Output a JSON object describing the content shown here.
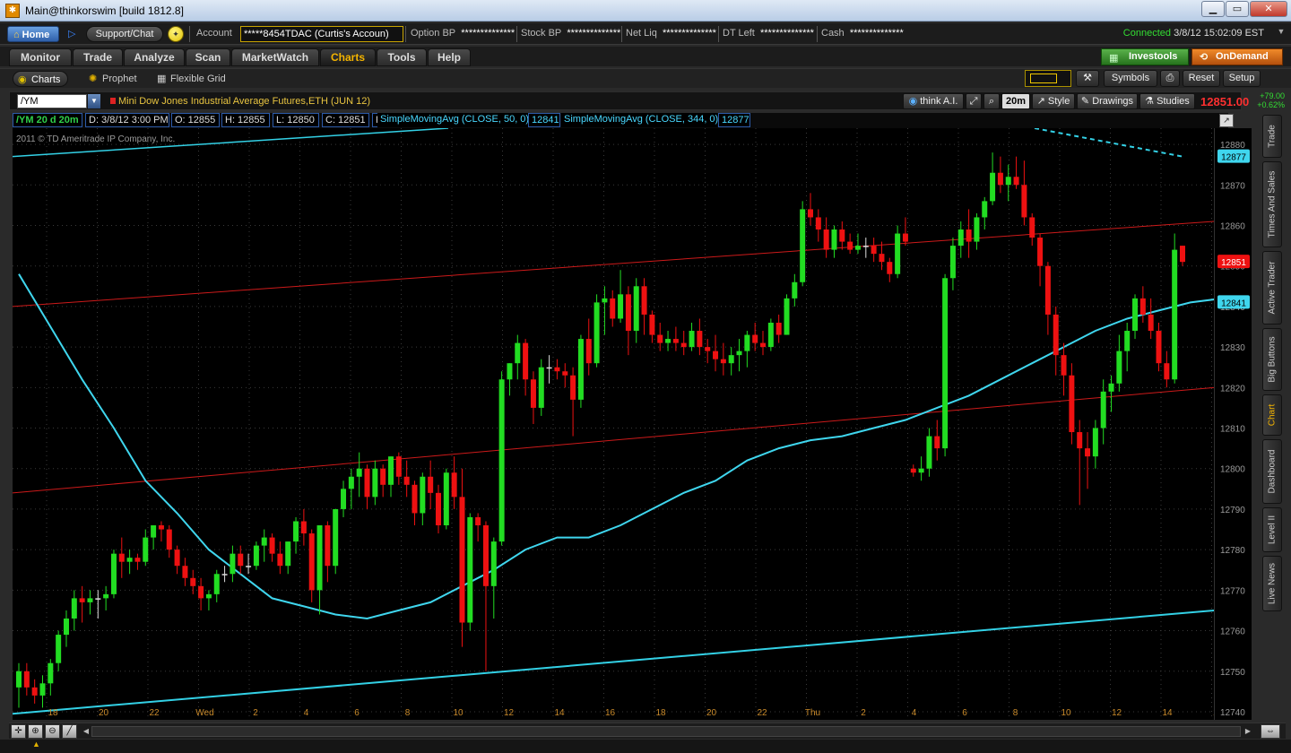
{
  "window": {
    "title": "Main@thinkorswim [build 1812.8]",
    "app_icon": "thinkorswim-icon",
    "controls": [
      "minimize",
      "maximize",
      "close"
    ]
  },
  "account_bar": {
    "home_label": "Home",
    "support_label": "Support/Chat",
    "account_label": "Account",
    "account_value": "*****8454TDAC (Curtis's Accoun)",
    "option_bp_label": "Option BP",
    "option_bp_value": "**************",
    "stock_bp_label": "Stock BP",
    "stock_bp_value": "**************",
    "net_liq_label": "Net Liq",
    "net_liq_value": "**************",
    "dt_left_label": "DT Left",
    "dt_left_value": "**************",
    "cash_label": "Cash",
    "cash_value": "**************",
    "connected_label": "Connected",
    "timestamp": "3/8/12 15:02:09 EST"
  },
  "main_tabs": {
    "items": [
      {
        "label": "Monitor",
        "active": false
      },
      {
        "label": "Trade",
        "active": false
      },
      {
        "label": "Analyze",
        "active": false
      },
      {
        "label": "Scan",
        "active": false
      },
      {
        "label": "MarketWatch",
        "active": false
      },
      {
        "label": "Charts",
        "active": true
      },
      {
        "label": "Tools",
        "active": false
      },
      {
        "label": "Help",
        "active": false
      }
    ],
    "investools_label": "Investools",
    "ondemand_label": "OnDemand"
  },
  "sub_tabs": {
    "charts_label": "Charts",
    "prophet_label": "Prophet",
    "flexible_grid_label": "Flexible Grid",
    "symbols_label": "Symbols",
    "reset_label": "Reset",
    "setup_label": "Setup"
  },
  "chart_header": {
    "symbol": "/YM",
    "description": "Mini Dow Jones Industrial Average Futures,ETH (JUN 12)",
    "think_ai_label": "think A.I.",
    "timeframe_label": "20m",
    "style_label": "Style",
    "drawings_label": "Drawings",
    "studies_label": "Studies",
    "last_price": "12851.00",
    "change": "+79.00",
    "change_pct": "+0.62%"
  },
  "study_bar": {
    "symbol_period": "/YM 20 d 20m",
    "date": "D: 3/8/12 3:00 PM",
    "open": "O: 12855",
    "high": "H: 12855",
    "low": "L: 12850",
    "close": "C: 12851",
    "range": "R: 5",
    "sma1_label": "SimpleMovingAvg (CLOSE, 50, 0)",
    "sma1_value": "12841",
    "sma2_label": "SimpleMovingAvg (CLOSE, 344, 0)",
    "sma2_value": "12877"
  },
  "side_tabs": [
    {
      "label": "Trade",
      "active": false
    },
    {
      "label": "Times And Sales",
      "active": false
    },
    {
      "label": "Active Trader",
      "active": false
    },
    {
      "label": "Big Buttons",
      "active": false
    },
    {
      "label": "Chart",
      "active": true
    },
    {
      "label": "Dashboard",
      "active": false
    },
    {
      "label": "Level II",
      "active": false
    },
    {
      "label": "Live News",
      "active": false
    }
  ],
  "colors": {
    "up": "#22dd22",
    "down": "#ee1111",
    "sma": "#3fd6ee",
    "channel": "#cc1a1a",
    "trend": "#33d1e6",
    "grid": "#3a3a3a",
    "accent": "#f4b400"
  },
  "chart_data": {
    "type": "candlestick",
    "copyright": "2011 © TD Ameritrade IP Company, Inc.",
    "y_ticks": [
      12740,
      12750,
      12760,
      12770,
      12780,
      12790,
      12800,
      12810,
      12820,
      12830,
      12840,
      12850,
      12860,
      12870,
      12880
    ],
    "ylim": [
      12738,
      12884
    ],
    "x_ticks": [
      "18",
      "20",
      "22",
      "Wed",
      "2",
      "4",
      "6",
      "8",
      "10",
      "12",
      "14",
      "16",
      "18",
      "20",
      "22",
      "Thu",
      "2",
      "4",
      "6",
      "8",
      "10",
      "12",
      "14",
      "16"
    ],
    "price_tags": [
      {
        "value": 12877,
        "label": "12877",
        "kind": "sma"
      },
      {
        "value": 12851,
        "label": "12851",
        "kind": "last"
      },
      {
        "value": 12841,
        "label": "12841",
        "kind": "sma"
      }
    ],
    "candles": [
      [
        12746,
        12752,
        12741,
        12750
      ],
      [
        12750,
        12752,
        12744,
        12746
      ],
      [
        12746,
        12748,
        12742,
        12744
      ],
      [
        12744,
        12749,
        12741,
        12747
      ],
      [
        12747,
        12753,
        12744,
        12752
      ],
      [
        12752,
        12760,
        12750,
        12759
      ],
      [
        12759,
        12765,
        12756,
        12763
      ],
      [
        12763,
        12770,
        12760,
        12768
      ],
      [
        12768,
        12771,
        12762,
        12767
      ],
      [
        12767,
        12770,
        12764,
        12768
      ],
      [
        12768,
        12770,
        12763,
        12768
      ],
      [
        12768,
        12771,
        12765,
        12769
      ],
      [
        12769,
        12780,
        12768,
        12779
      ],
      [
        12779,
        12783,
        12773,
        12777
      ],
      [
        12777,
        12780,
        12774,
        12778
      ],
      [
        12778,
        12779,
        12775,
        12777
      ],
      [
        12777,
        12785,
        12776,
        12783
      ],
      [
        12783,
        12786,
        12780,
        12786
      ],
      [
        12786,
        12787,
        12782,
        12785
      ],
      [
        12785,
        12786,
        12778,
        12780
      ],
      [
        12780,
        12781,
        12774,
        12776
      ],
      [
        12776,
        12778,
        12771,
        12773
      ],
      [
        12773,
        12775,
        12769,
        12771
      ],
      [
        12771,
        12773,
        12765,
        12768
      ],
      [
        12768,
        12770,
        12765,
        12769
      ],
      [
        12769,
        12775,
        12767,
        12774
      ],
      [
        12774,
        12776,
        12772,
        12774
      ],
      [
        12774,
        12781,
        12772,
        12779
      ],
      [
        12779,
        12781,
        12774,
        12776
      ],
      [
        12776,
        12779,
        12774,
        12776
      ],
      [
        12776,
        12782,
        12775,
        12781
      ],
      [
        12781,
        12785,
        12777,
        12783
      ],
      [
        12783,
        12784,
        12777,
        12779
      ],
      [
        12779,
        12782,
        12774,
        12776
      ],
      [
        12776,
        12782,
        12774,
        12782
      ],
      [
        12782,
        12788,
        12779,
        12787
      ],
      [
        12787,
        12790,
        12781,
        12784
      ],
      [
        12784,
        12785,
        12767,
        12770
      ],
      [
        12770,
        12786,
        12764,
        12786
      ],
      [
        12786,
        12787,
        12772,
        12776
      ],
      [
        12776,
        12790,
        12774,
        12790
      ],
      [
        12790,
        12797,
        12788,
        12795
      ],
      [
        12795,
        12800,
        12790,
        12798
      ],
      [
        12798,
        12804,
        12793,
        12800
      ],
      [
        12800,
        12801,
        12790,
        12793
      ],
      [
        12793,
        12802,
        12791,
        12800
      ],
      [
        12800,
        12801,
        12793,
        12796
      ],
      [
        12796,
        12803,
        12793,
        12803
      ],
      [
        12803,
        12804,
        12796,
        12798
      ],
      [
        12798,
        12802,
        12793,
        12796
      ],
      [
        12796,
        12797,
        12786,
        12789
      ],
      [
        12789,
        12799,
        12786,
        12798
      ],
      [
        12798,
        12802,
        12790,
        12794
      ],
      [
        12794,
        12796,
        12784,
        12786
      ],
      [
        12786,
        12800,
        12785,
        12799
      ],
      [
        12799,
        12803,
        12790,
        12793
      ],
      [
        12793,
        12800,
        12756,
        12762
      ],
      [
        12762,
        12789,
        12760,
        12788
      ],
      [
        12788,
        12789,
        12782,
        12786
      ],
      [
        12786,
        12787,
        12750,
        12771
      ],
      [
        12771,
        12783,
        12763,
        12782
      ],
      [
        12782,
        12824,
        12781,
        12822
      ],
      [
        12822,
        12826,
        12818,
        12826
      ],
      [
        12826,
        12833,
        12822,
        12831
      ],
      [
        12831,
        12832,
        12818,
        12822
      ],
      [
        12822,
        12824,
        12811,
        12815
      ],
      [
        12815,
        12827,
        12813,
        12825
      ],
      [
        12825,
        12828,
        12821,
        12825
      ],
      [
        12825,
        12827,
        12822,
        12824
      ],
      [
        12824,
        12826,
        12820,
        12823
      ],
      [
        12823,
        12825,
        12808,
        12817
      ],
      [
        12817,
        12833,
        12815,
        12832
      ],
      [
        12832,
        12837,
        12823,
        12826
      ],
      [
        12826,
        12843,
        12825,
        12841
      ],
      [
        12841,
        12845,
        12833,
        12842
      ],
      [
        12842,
        12844,
        12835,
        12837
      ],
      [
        12837,
        12849,
        12836,
        12843
      ],
      [
        12843,
        12845,
        12828,
        12834
      ],
      [
        12834,
        12847,
        12831,
        12845
      ],
      [
        12845,
        12847,
        12833,
        12838
      ],
      [
        12838,
        12839,
        12831,
        12833
      ],
      [
        12833,
        12836,
        12829,
        12831
      ],
      [
        12831,
        12834,
        12829,
        12832
      ],
      [
        12832,
        12835,
        12829,
        12831
      ],
      [
        12831,
        12834,
        12828,
        12830
      ],
      [
        12830,
        12836,
        12829,
        12834
      ],
      [
        12834,
        12837,
        12828,
        12830
      ],
      [
        12830,
        12832,
        12826,
        12829
      ],
      [
        12829,
        12833,
        12824,
        12827
      ],
      [
        12827,
        12831,
        12823,
        12826
      ],
      [
        12826,
        12830,
        12823,
        12828
      ],
      [
        12828,
        12832,
        12824,
        12829
      ],
      [
        12829,
        12834,
        12825,
        12833
      ],
      [
        12833,
        12836,
        12829,
        12831
      ],
      [
        12831,
        12834,
        12828,
        12830
      ],
      [
        12830,
        12837,
        12829,
        12836
      ],
      [
        12836,
        12838,
        12831,
        12833
      ],
      [
        12833,
        12843,
        12833,
        12842
      ],
      [
        12842,
        12848,
        12840,
        12846
      ],
      [
        12846,
        12866,
        12845,
        12864
      ],
      [
        12864,
        12868,
        12860,
        12862
      ],
      [
        12862,
        12864,
        12856,
        12859
      ],
      [
        12859,
        12862,
        12852,
        12854
      ],
      [
        12854,
        12860,
        12852,
        12859
      ],
      [
        12859,
        12861,
        12854,
        12856
      ],
      [
        12856,
        12858,
        12853,
        12854
      ],
      [
        12854,
        12858,
        12853,
        12855
      ],
      [
        12855,
        12857,
        12852,
        12855
      ],
      [
        12855,
        12857,
        12851,
        12853
      ],
      [
        12853,
        12856,
        12849,
        12851
      ],
      [
        12851,
        12852,
        12846,
        12848
      ],
      [
        12848,
        12860,
        12847,
        12858
      ],
      [
        12858,
        12862,
        12855,
        12856
      ],
      [
        12800,
        12801,
        12798,
        12799
      ],
      [
        12799,
        12803,
        12797,
        12800
      ],
      [
        12800,
        12810,
        12798,
        12808
      ],
      [
        12808,
        12812,
        12802,
        12805
      ],
      [
        12805,
        12848,
        12803,
        12847
      ],
      [
        12847,
        12857,
        12844,
        12855
      ],
      [
        12855,
        12861,
        12852,
        12859
      ],
      [
        12859,
        12864,
        12852,
        12856
      ],
      [
        12856,
        12863,
        12854,
        12862
      ],
      [
        12862,
        12867,
        12859,
        12866
      ],
      [
        12866,
        12878,
        12865,
        12873
      ],
      [
        12873,
        12877,
        12868,
        12870
      ],
      [
        12870,
        12875,
        12866,
        12872
      ],
      [
        12872,
        12877,
        12869,
        12870
      ],
      [
        12870,
        12876,
        12860,
        12862
      ],
      [
        12862,
        12863,
        12855,
        12857
      ],
      [
        12857,
        12858,
        12845,
        12850
      ],
      [
        12850,
        12851,
        12833,
        12838
      ],
      [
        12838,
        12840,
        12823,
        12828
      ],
      [
        12828,
        12831,
        12818,
        12823
      ],
      [
        12823,
        12826,
        12806,
        12809
      ],
      [
        12809,
        12812,
        12791,
        12805
      ],
      [
        12805,
        12809,
        12795,
        12803
      ],
      [
        12803,
        12812,
        12800,
        12810
      ],
      [
        12810,
        12822,
        12806,
        12819
      ],
      [
        12819,
        12823,
        12814,
        12821
      ],
      [
        12821,
        12833,
        12819,
        12829
      ],
      [
        12829,
        12836,
        12824,
        12834
      ],
      [
        12834,
        12843,
        12832,
        12842
      ],
      [
        12842,
        12845,
        12836,
        12838
      ],
      [
        12838,
        12842,
        12832,
        12834
      ],
      [
        12834,
        12836,
        12824,
        12826
      ],
      [
        12826,
        12829,
        12820,
        12822
      ],
      [
        12822,
        12858,
        12821,
        12854
      ],
      [
        12855,
        12855,
        12850,
        12851
      ]
    ],
    "sma_50": [
      [
        0,
        12848
      ],
      [
        4,
        12835
      ],
      [
        8,
        12822
      ],
      [
        12,
        12810
      ],
      [
        16,
        12797
      ],
      [
        20,
        12789
      ],
      [
        24,
        12780
      ],
      [
        28,
        12774
      ],
      [
        32,
        12768
      ],
      [
        36,
        12766
      ],
      [
        40,
        12764
      ],
      [
        44,
        12763
      ],
      [
        48,
        12765
      ],
      [
        52,
        12767
      ],
      [
        56,
        12771
      ],
      [
        60,
        12775
      ],
      [
        64,
        12780
      ],
      [
        68,
        12783
      ],
      [
        72,
        12783
      ],
      [
        76,
        12786
      ],
      [
        80,
        12790
      ],
      [
        84,
        12794
      ],
      [
        88,
        12797
      ],
      [
        92,
        12802
      ],
      [
        96,
        12805
      ],
      [
        100,
        12807
      ],
      [
        104,
        12808
      ],
      [
        108,
        12810
      ],
      [
        112,
        12812
      ],
      [
        116,
        12815
      ],
      [
        120,
        12818
      ],
      [
        124,
        12822
      ],
      [
        128,
        12826
      ],
      [
        132,
        12830
      ],
      [
        136,
        12834
      ],
      [
        140,
        12837
      ],
      [
        144,
        12839
      ],
      [
        148,
        12841
      ],
      [
        152,
        12842
      ],
      [
        156,
        12843
      ],
      [
        160,
        12845
      ],
      [
        164,
        12842
      ],
      [
        168,
        12842
      ],
      [
        172,
        12841
      ],
      [
        176,
        12842
      ],
      [
        180,
        12841
      ]
    ]
  }
}
